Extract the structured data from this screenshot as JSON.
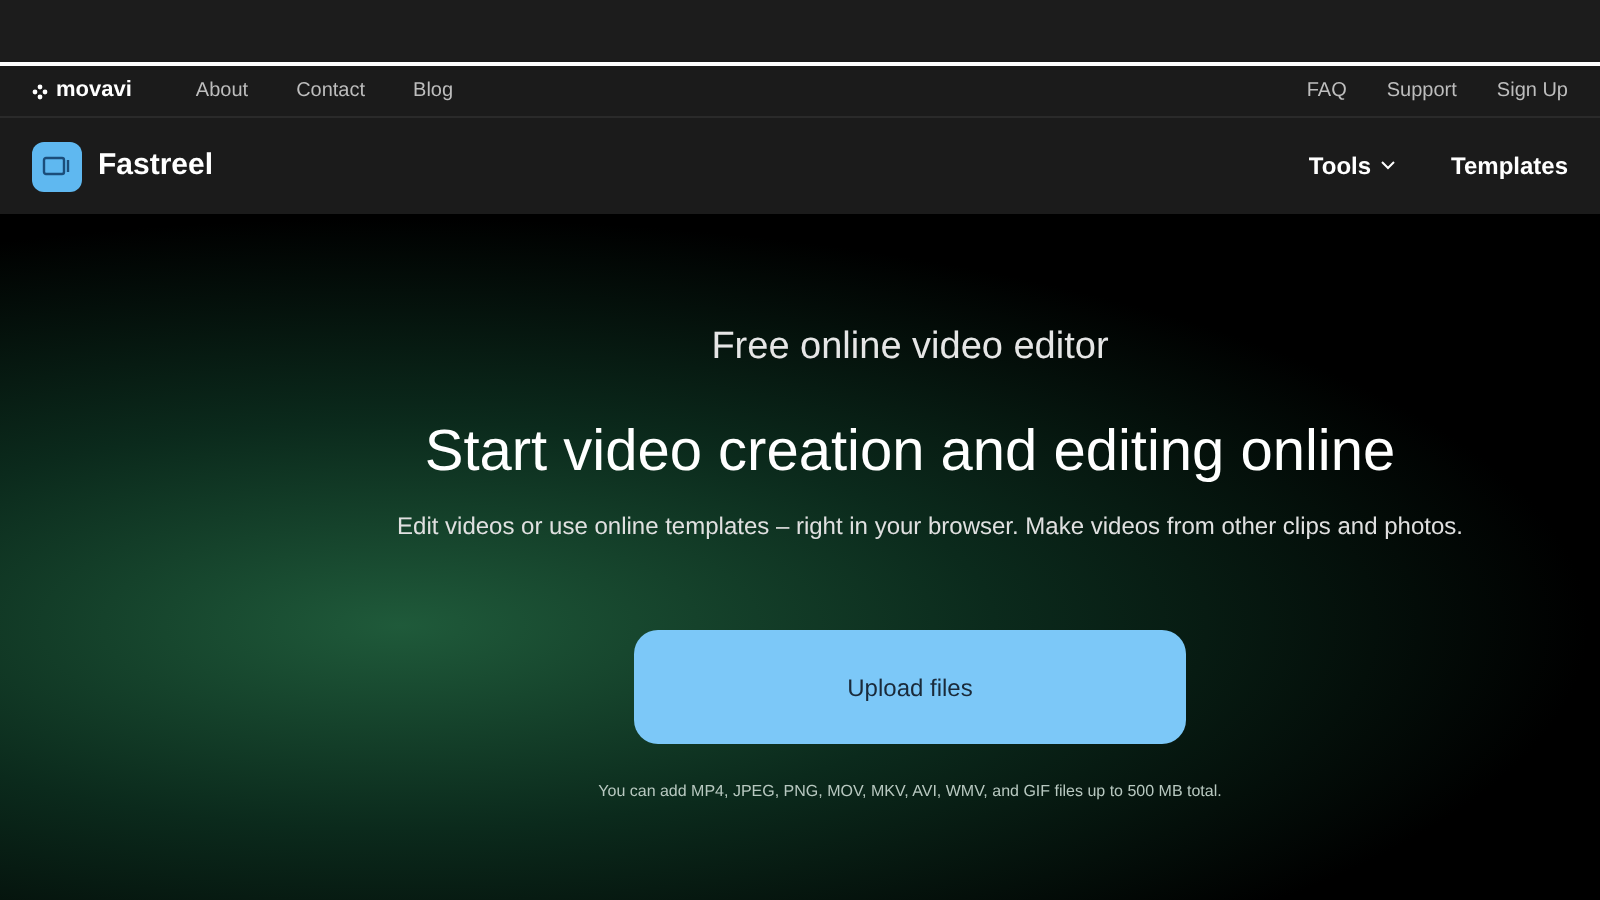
{
  "top_nav": {
    "brand": "movavi",
    "links": [
      "About",
      "Contact",
      "Blog"
    ],
    "right_links": [
      "FAQ",
      "Support",
      "Sign Up"
    ]
  },
  "main_nav": {
    "brand": "Fastreel",
    "items": [
      {
        "label": "Tools",
        "kind": "dropdown"
      },
      {
        "label": "Templates",
        "kind": "link"
      }
    ]
  },
  "hero": {
    "eyebrow": "Free online video editor",
    "title": "Start video creation and editing online",
    "subtitle": "Edit videos or use online templates – right in your browser. Make videos from other clips and photos.",
    "button": "Upload files",
    "note": "You can add MP4, JPEG, PNG, MOV, MKV, AVI, WMV, and GIF files up to 500 MB total."
  }
}
